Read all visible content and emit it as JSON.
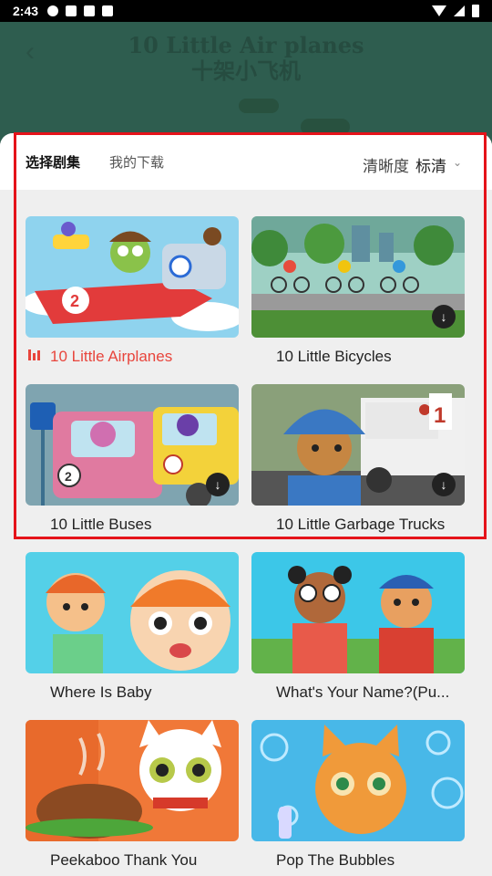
{
  "status_bar": {
    "time": "2:43"
  },
  "video": {
    "title_en": "10 Little Air planes",
    "title_zh": "十架小飞机"
  },
  "sheet": {
    "tabs": [
      {
        "label": "选择剧集",
        "active": true
      },
      {
        "label": "我的下载",
        "active": false
      }
    ],
    "quality_label": "清晰度",
    "quality_value": "标清"
  },
  "episodes": [
    {
      "title": "10 Little Airplanes",
      "playing": true,
      "downloaded": false
    },
    {
      "title": "10 Little Bicycles",
      "playing": false,
      "downloaded": true
    },
    {
      "title": "10 Little Buses",
      "playing": false,
      "downloaded": true
    },
    {
      "title": "10 Little Garbage Trucks",
      "playing": false,
      "downloaded": true
    },
    {
      "title": "Where Is Baby",
      "playing": false,
      "downloaded": false
    },
    {
      "title": "What's Your Name?(Pu...",
      "playing": false,
      "downloaded": false
    },
    {
      "title": "Peekaboo Thank You",
      "playing": false,
      "downloaded": false
    },
    {
      "title": "Pop The Bubbles",
      "playing": false,
      "downloaded": false
    }
  ],
  "colors": {
    "accent": "#e8453c",
    "highlight_border": "#e5131a"
  },
  "icons": [
    "back-arrow-icon",
    "chevron-down-icon",
    "download-icon",
    "playing-bars-icon"
  ]
}
